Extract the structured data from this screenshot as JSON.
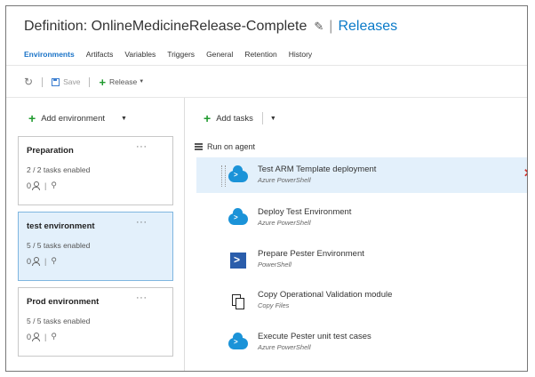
{
  "header": {
    "title": "Definition: OnlineMedicineRelease-Complete",
    "releases_link": "Releases"
  },
  "tabs": [
    "Environments",
    "Artifacts",
    "Variables",
    "Triggers",
    "General",
    "Retention",
    "History"
  ],
  "toolbar": {
    "save_label": "Save",
    "release_label": "Release"
  },
  "left_panel": {
    "add_environment_label": "Add environment",
    "environments": [
      {
        "name": "Preparation",
        "tasks_enabled": "2 / 2 tasks enabled",
        "approvers_count": "0"
      },
      {
        "name": "test environment",
        "tasks_enabled": "5 / 5 tasks enabled",
        "approvers_count": "0"
      },
      {
        "name": "Prod environment",
        "tasks_enabled": "5 / 5 tasks enabled",
        "approvers_count": "0"
      }
    ],
    "more_glyph": "···"
  },
  "right_panel": {
    "add_tasks_label": "Add tasks",
    "phase_label": "Run on agent",
    "tasks": [
      {
        "name": "Test ARM Template deployment",
        "type": "Azure PowerShell",
        "icon": "azure-cloud-icon"
      },
      {
        "name": "Deploy Test Environment",
        "type": "Azure PowerShell",
        "icon": "azure-cloud-icon"
      },
      {
        "name": "Prepare Pester Environment",
        "type": "PowerShell",
        "icon": "powershell-icon"
      },
      {
        "name": "Copy Operational Validation module",
        "type": "Copy Files",
        "icon": "copy-files-icon"
      },
      {
        "name": "Execute Pester unit test cases",
        "type": "Azure PowerShell",
        "icon": "azure-cloud-icon"
      }
    ]
  },
  "colors": {
    "accent_blue": "#1a73c7",
    "selected_bg": "#e3f0fb",
    "add_green": "#1f9a2e",
    "remove_red": "#d0342c"
  }
}
